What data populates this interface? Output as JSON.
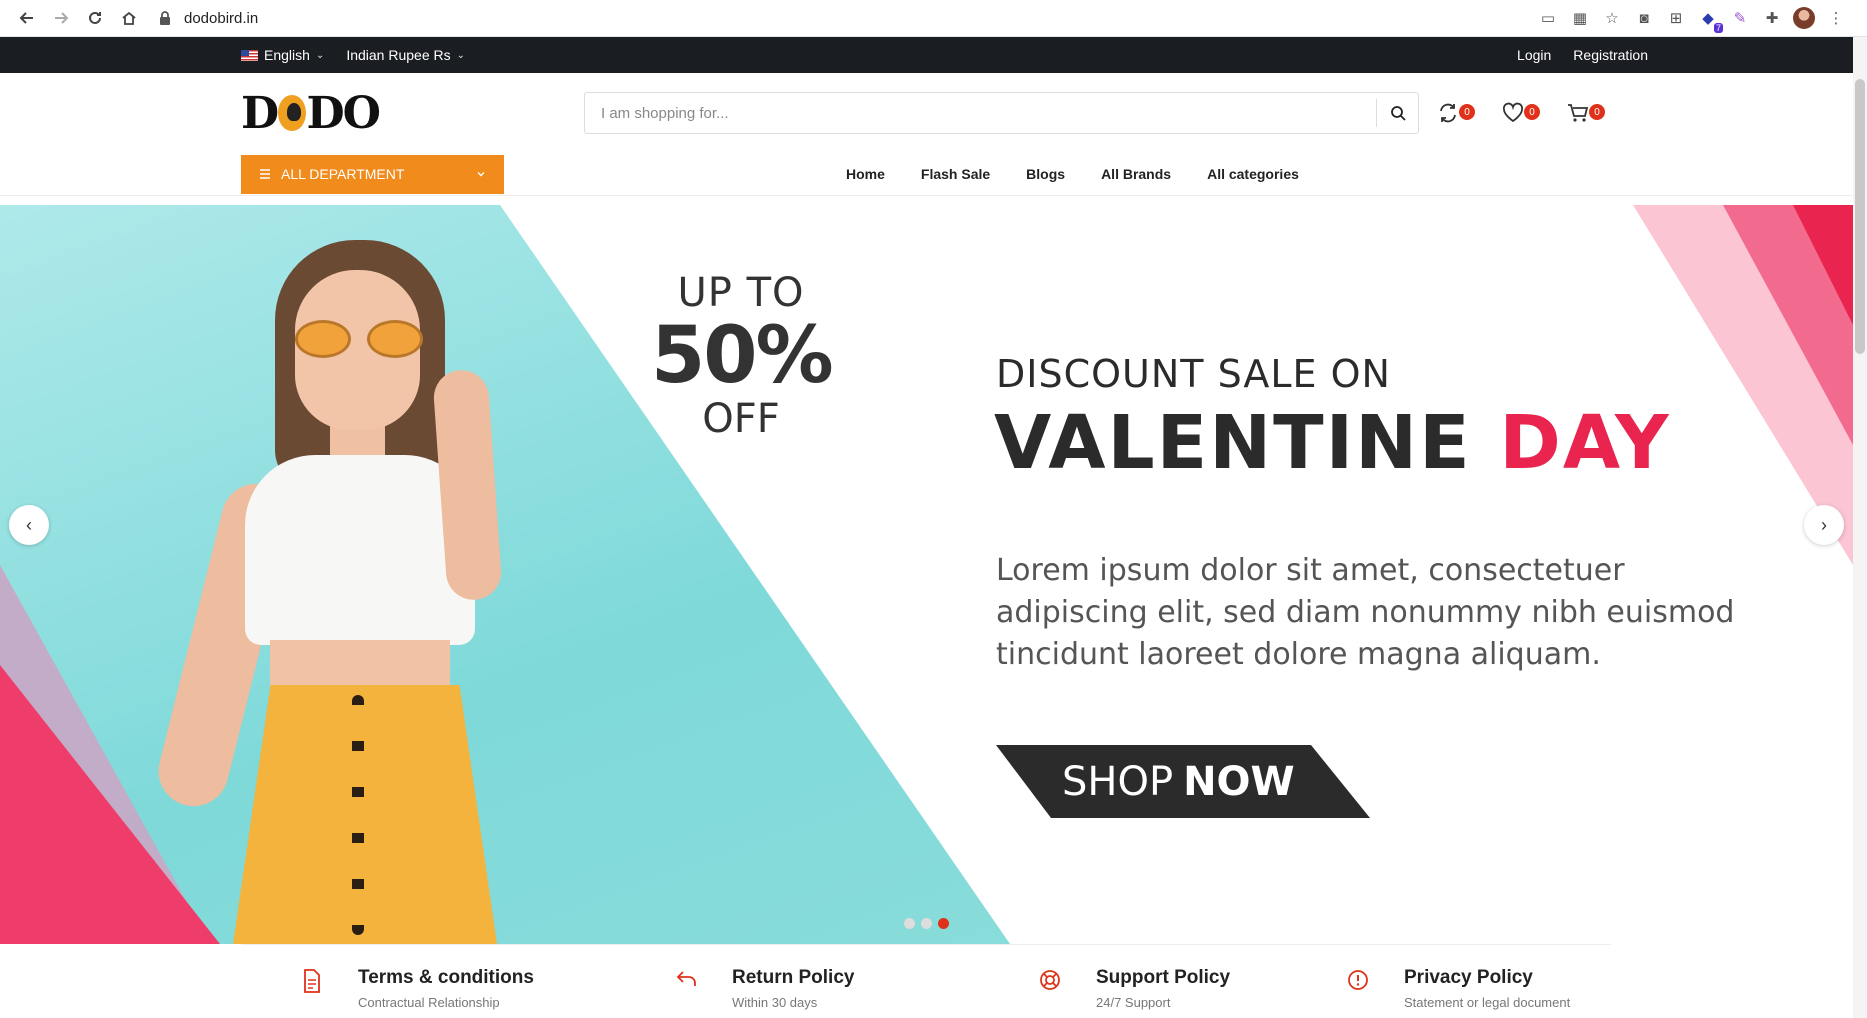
{
  "browser": {
    "url": "dodobird.in",
    "ext_badge": "7"
  },
  "topbar": {
    "language": "English",
    "currency": "Indian Rupee Rs",
    "login": "Login",
    "registration": "Registration"
  },
  "header": {
    "search_placeholder": "I am shopping for...",
    "compare_count": "0",
    "wishlist_count": "0",
    "cart_count": "0"
  },
  "nav": {
    "department": "ALL DEPARTMENT",
    "menu": [
      "Home",
      "Flash Sale",
      "Blogs",
      "All Brands",
      "All categories"
    ]
  },
  "hero": {
    "upto": "UP TO",
    "percent": "50%",
    "off": "OFF",
    "discount_line": "DISCOUNT SALE ON",
    "title_dark": "VALENTINE",
    "title_red": "DAY",
    "lorem": "Lorem ipsum dolor sit amet, consectetuer adipiscing elit, sed diam nonummy nibh euismod tincidunt laoreet dolore magna aliquam.",
    "shop": "SHOP",
    "now": "NOW",
    "slide_count": 3,
    "active_slide": 3
  },
  "policies": [
    {
      "title": "Terms & conditions",
      "subtitle": "Contractual Relationship",
      "icon": "document-icon"
    },
    {
      "title": "Return Policy",
      "subtitle": "Within 30 days",
      "icon": "return-arrow-icon"
    },
    {
      "title": "Support Policy",
      "subtitle": "24/7 Support",
      "icon": "lifebuoy-icon"
    },
    {
      "title": "Privacy Policy",
      "subtitle": "Statement or legal document",
      "icon": "alert-circle-icon"
    }
  ],
  "colors": {
    "accent": "#f18b1c",
    "red": "#e0321a",
    "topbar": "#1a1d21",
    "valentine_red": "#e9244f"
  }
}
